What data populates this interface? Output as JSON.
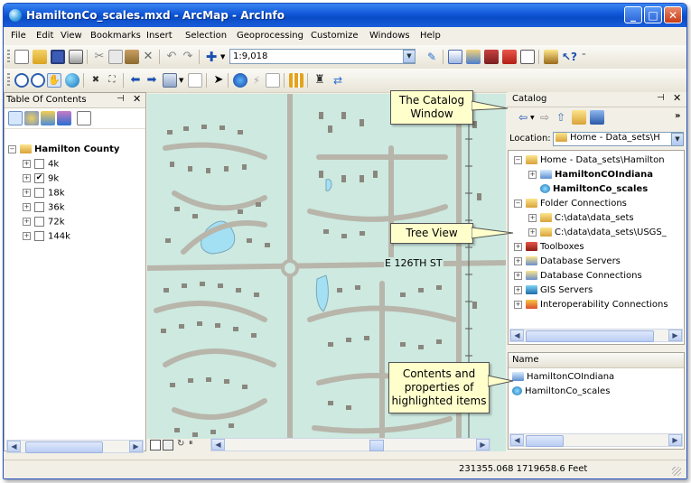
{
  "window": {
    "title": "HamiltonCo_scales.mxd - ArcMap - ArcInfo",
    "minimize": "_",
    "maximize": "□",
    "close": "✕"
  },
  "menu": [
    "File",
    "Edit",
    "View",
    "Bookmarks",
    "Insert",
    "Selection",
    "Geoprocessing",
    "Customize",
    "Windows",
    "Help"
  ],
  "toolbar": {
    "scale_value": "1:9,018"
  },
  "toc": {
    "title": "Table Of Contents",
    "pin": "ᵖ",
    "close": "✕",
    "group": "Hamilton County",
    "layers": [
      {
        "label": "4k",
        "checked": false
      },
      {
        "label": "9k",
        "checked": true
      },
      {
        "label": "18k",
        "checked": false
      },
      {
        "label": "36k",
        "checked": false
      },
      {
        "label": "72k",
        "checked": false
      },
      {
        "label": "144k",
        "checked": false
      }
    ],
    "check_mark": "✔"
  },
  "map": {
    "street_label": "E 126TH ST",
    "colors": {
      "land": "#cde9e0",
      "road": "#b8b5ab",
      "building": "#8a877e",
      "water": "#a3e0f4"
    }
  },
  "catalog": {
    "title": "Catalog",
    "location_label": "Location:",
    "location_value": "Home - Data_sets\\H",
    "home": "Home - Data_sets\\Hamilton",
    "home_children": [
      "HamiltonCOIndiana",
      "HamiltonCo_scales"
    ],
    "folder_connections": "Folder Connections",
    "folders": [
      "C:\\data\\data_sets",
      "C:\\data\\data_sets\\USGS_"
    ],
    "other_items": [
      "Toolboxes",
      "Database Servers",
      "Database Connections",
      "GIS Servers",
      "Interoperability Connections"
    ],
    "contents_header": "Name",
    "contents_items": [
      "HamiltonCOIndiana",
      "HamiltonCo_scales"
    ]
  },
  "callouts": {
    "catalog_window": [
      "The Catalog",
      "Window"
    ],
    "tree_view": "Tree View",
    "contents": [
      "Contents and",
      "properties of",
      "highlighted items"
    ]
  },
  "status": {
    "coordinates": "231355.068  1719658.6 Feet"
  }
}
